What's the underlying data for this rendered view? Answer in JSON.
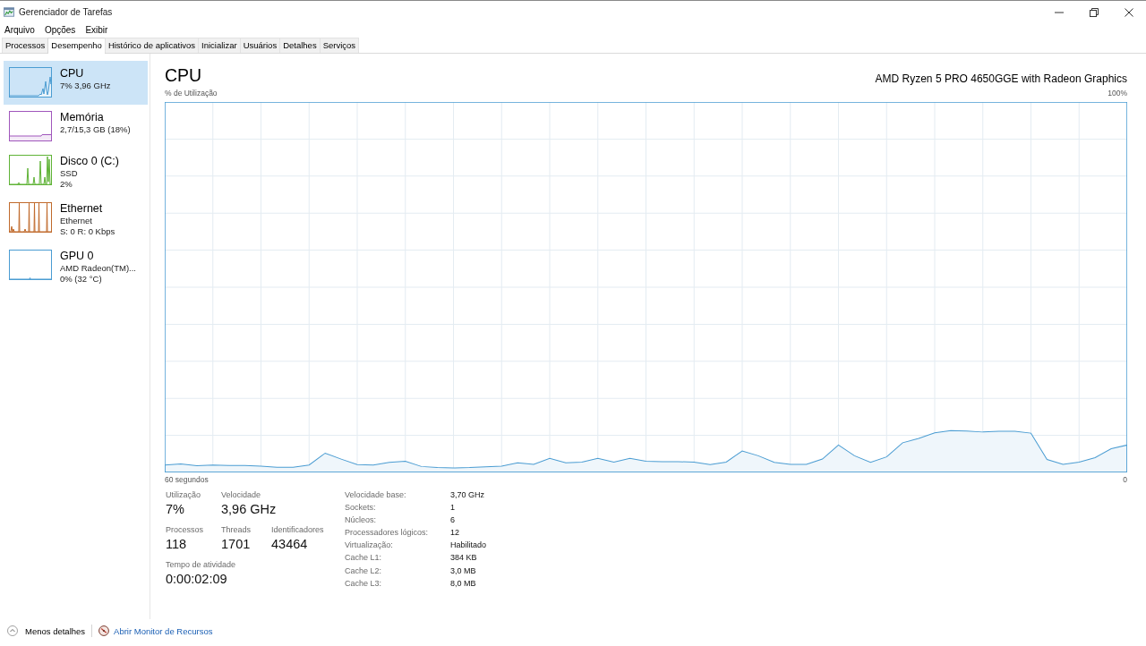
{
  "window": {
    "title": "Gerenciador de Tarefas"
  },
  "menu": [
    "Arquivo",
    "Opções",
    "Exibir"
  ],
  "tabs": [
    {
      "label": "Processos",
      "selected": false
    },
    {
      "label": "Desempenho",
      "selected": true
    },
    {
      "label": "Histórico de aplicativos",
      "selected": false
    },
    {
      "label": "Inicializar",
      "selected": false
    },
    {
      "label": "Usuários",
      "selected": false
    },
    {
      "label": "Detalhes",
      "selected": false
    },
    {
      "label": "Serviços",
      "selected": false
    }
  ],
  "sidebar": {
    "items": [
      {
        "kind": "cpu",
        "name": "CPU",
        "lines": [
          "7% 3,96 GHz"
        ],
        "color": "#4a9cd2",
        "selected": true
      },
      {
        "kind": "memory",
        "name": "Memória",
        "lines": [
          "2,7/15,3 GB (18%)"
        ],
        "color": "#a056bc",
        "selected": false
      },
      {
        "kind": "disk",
        "name": "Disco 0 (C:)",
        "lines": [
          "SSD",
          "2%"
        ],
        "color": "#5fb336",
        "selected": false
      },
      {
        "kind": "network",
        "name": "Ethernet",
        "lines": [
          "Ethernet",
          "S: 0 R: 0 Kbps"
        ],
        "color": "#c06a2c",
        "selected": false
      },
      {
        "kind": "gpu",
        "name": "GPU 0",
        "lines": [
          "AMD Radeon(TM)...",
          "0% (32 °C)"
        ],
        "color": "#4a9cd2",
        "selected": false
      }
    ]
  },
  "panel": {
    "title": "CPU",
    "processor": "AMD Ryzen 5 PRO 4650GGE with Radeon Graphics",
    "graph": {
      "usage_label": "% de Utilização",
      "scale_max_label": "100%",
      "time_span_label": "60 segundos",
      "scale_min_label": "0"
    },
    "stats": [
      [
        {
          "label": "Utilização",
          "value": "7%"
        },
        {
          "label": "Velocidade",
          "value": "3,96 GHz"
        }
      ],
      [
        {
          "label": "Processos",
          "value": "118"
        },
        {
          "label": "Threads",
          "value": "1701"
        },
        {
          "label": "Identificadores",
          "value": "43464"
        }
      ],
      [
        {
          "label": "Tempo de atividade",
          "value": "0:00:02:09"
        }
      ]
    ],
    "details": [
      {
        "label": "Velocidade base:",
        "value": "3,70 GHz"
      },
      {
        "label": "Sockets:",
        "value": "1"
      },
      {
        "label": "Núcleos:",
        "value": "6"
      },
      {
        "label": "Processadores lógicos:",
        "value": "12"
      },
      {
        "label": "Virtualização:",
        "value": "Habilitado"
      },
      {
        "label": "Cache L1:",
        "value": "384 KB"
      },
      {
        "label": "Cache L2:",
        "value": "3,0 MB"
      },
      {
        "label": "Cache L3:",
        "value": "8,0 MB"
      }
    ]
  },
  "footer": {
    "less_details": "Menos detalhes",
    "resource_monitor_link": "Abrir Monitor de Recursos"
  }
}
